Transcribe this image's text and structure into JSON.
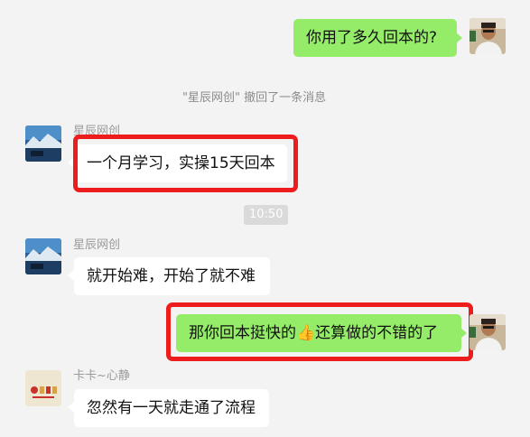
{
  "messages": {
    "m1": {
      "text": "你用了多久回本的?"
    },
    "recall_notice": "\"星辰网创\" 撤回了一条消息",
    "m2": {
      "sender": "星辰网创",
      "text": "一个月学习，实操15天回本"
    },
    "timestamp": "10:50",
    "m3": {
      "sender": "星辰网创",
      "text": "就开始难，开始了就不难"
    },
    "m4": {
      "text_before": "那你回本挺快的",
      "emoji": "👍",
      "text_after": "还算做的不错的了"
    },
    "m5": {
      "sender": "卡卡~心静",
      "text": "忽然有一天就走通了流程"
    }
  },
  "colors": {
    "self_bubble": "#95ec69",
    "other_bubble": "#ffffff",
    "highlight_box": "#ee1d1d",
    "background": "#f3f3f3"
  },
  "icons": {
    "self_avatar": "user-photo-avatar",
    "xingchen_avatar": "mountain-snow-avatar",
    "kaka_avatar": "kaka-logo-avatar"
  }
}
